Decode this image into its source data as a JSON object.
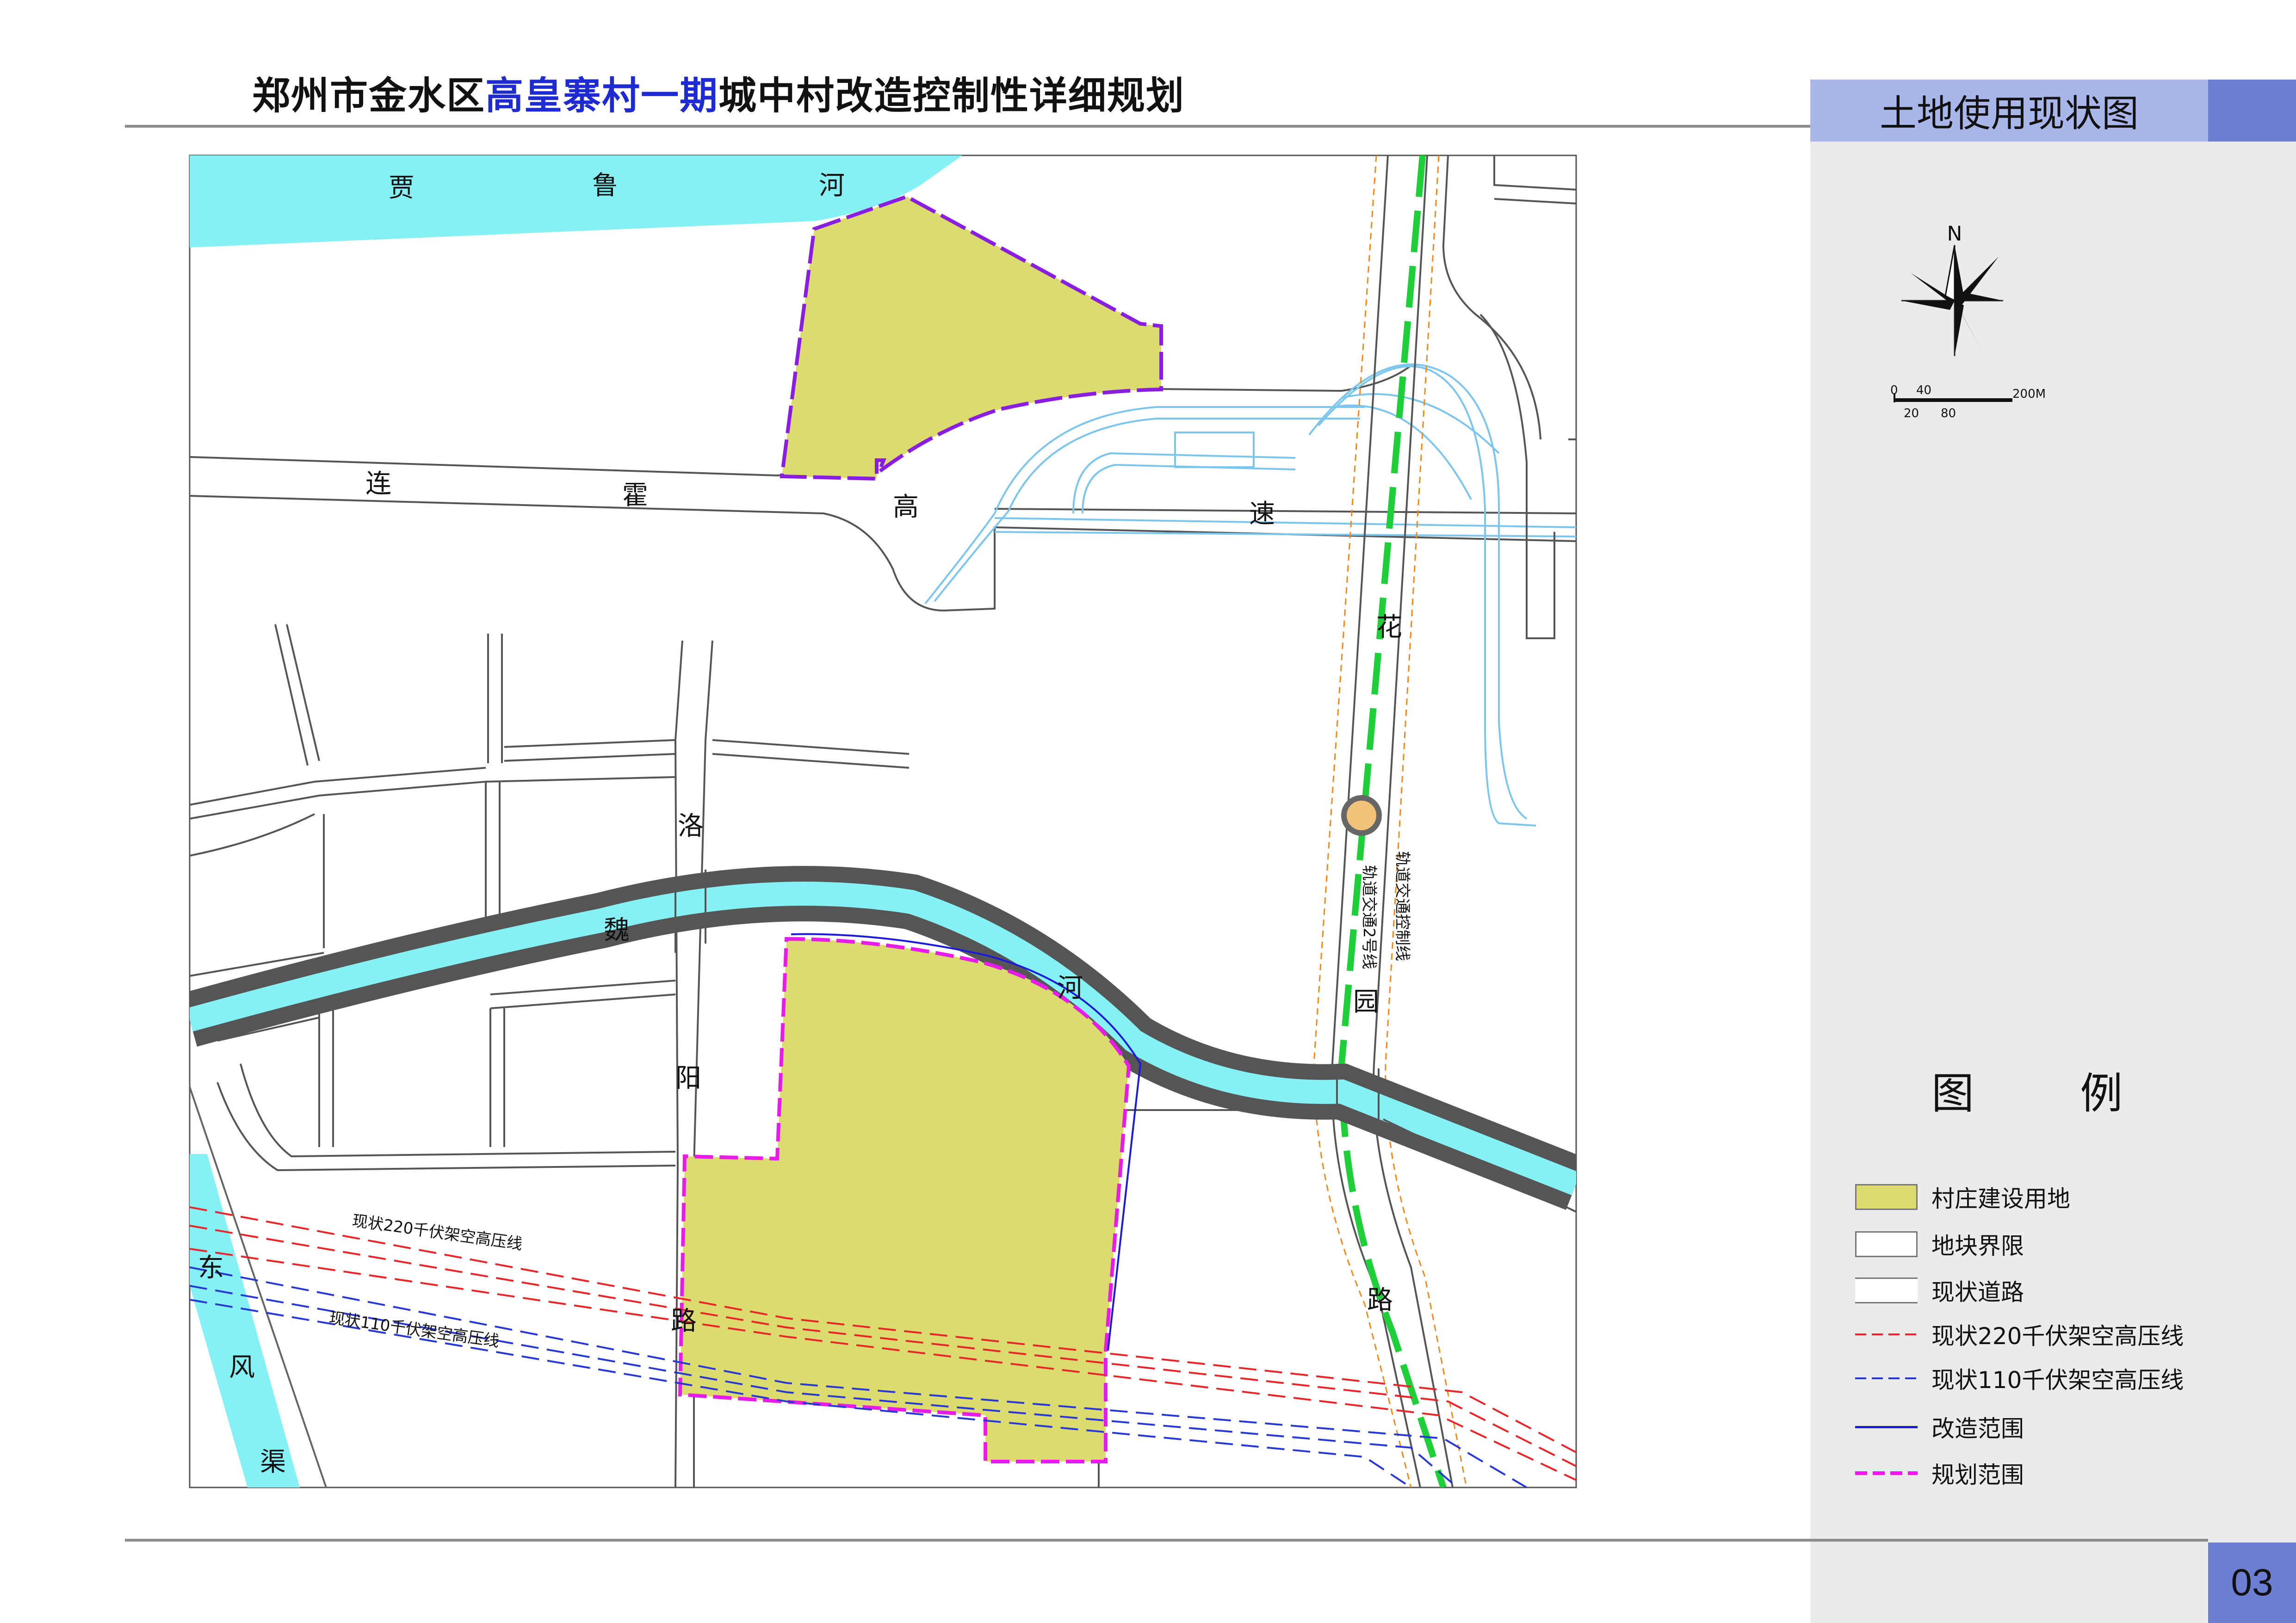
{
  "header": {
    "title_part1": "郑州市金水区",
    "title_highlight": "高皇寨村一期",
    "title_part2": "城中村改造控制性详细规划"
  },
  "map_title": "土地使用现状图",
  "page_number": "03",
  "compass": {
    "north_label": "N"
  },
  "scale_bar": {
    "labels_top": [
      "0",
      "40",
      "200M"
    ],
    "labels_bottom": [
      "20",
      "80"
    ]
  },
  "map_labels": {
    "jialu_river": [
      "贾",
      "鲁",
      "河"
    ],
    "lianhuo_expressway": [
      "连",
      "霍",
      "高",
      "速"
    ],
    "luoyang_road": [
      "洛",
      "阳",
      "路"
    ],
    "weihe_river": [
      "魏",
      "河"
    ],
    "huayuan_road": [
      "花",
      "园",
      "路"
    ],
    "dongfeng_canal": [
      "东",
      "风",
      "渠"
    ],
    "rail_line_2": "轨道交通2号线",
    "rail_control_line": "轨道交通控制线",
    "power_220": "现状220千伏架空高压线",
    "power_110": "现状110千伏架空高压线"
  },
  "legend": {
    "title": "图 例",
    "items": [
      {
        "label": "村庄建设用地",
        "swatch": "village-land"
      },
      {
        "label": "地块界限",
        "swatch": "parcel-boundary"
      },
      {
        "label": "现状道路",
        "swatch": "existing-road"
      },
      {
        "label": "现状220千伏架空高压线",
        "swatch": "power-220"
      },
      {
        "label": "现状110千伏架空高压线",
        "swatch": "power-110"
      },
      {
        "label": "改造范围",
        "swatch": "renovation-scope"
      },
      {
        "label": "规划范围",
        "swatch": "planning-scope"
      }
    ]
  },
  "colors": {
    "water": "#86f1f4",
    "village_land": "#dcdc6e",
    "rail_green": "#1ecf3a",
    "power_220": "#e8262a",
    "power_110": "#2838d4",
    "renovation_line": "#1a1ad8",
    "planning_line": "#e81ce8",
    "boundary_purple": "#8a1ee0",
    "rail_control_orange": "#f08a1e",
    "ramp_blue": "#7cc6ee",
    "panel_blue": "#a9b6e9",
    "panel_blue_dark": "#6c7fd2"
  }
}
